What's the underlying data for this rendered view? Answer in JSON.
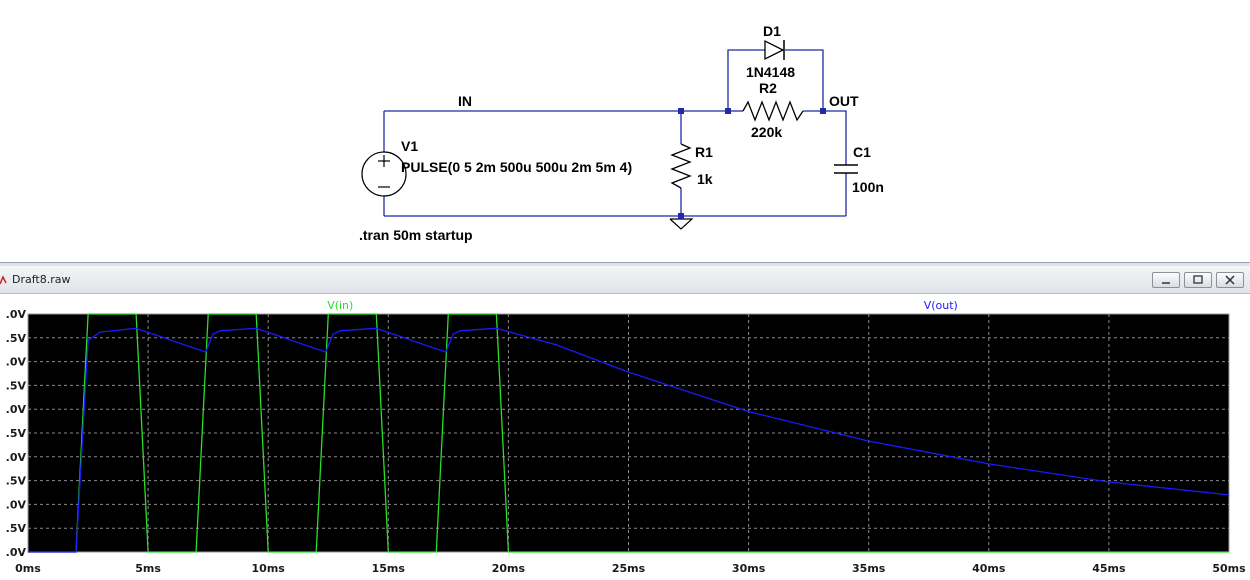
{
  "schematic": {
    "labels": {
      "net_in": "IN",
      "net_out": "OUT",
      "d1_name": "D1",
      "d1_model": "1N4148",
      "r2_name": "R2",
      "r2_value": "220k",
      "r1_name": "R1",
      "r1_value": "1k",
      "c1_name": "C1",
      "c1_value": "100n",
      "v1_name": "V1",
      "v1_value": "PULSE(0 5 2m 500u 500u 2m 5m 4)",
      "directive": ".tran 50m startup"
    }
  },
  "waveform_window": {
    "title": "Draft8.raw",
    "buttons": [
      "minimize",
      "restore",
      "close"
    ]
  },
  "chart_data": {
    "type": "line",
    "x_ticks": [
      "0ms",
      "5ms",
      "10ms",
      "15ms",
      "20ms",
      "25ms",
      "30ms",
      "35ms",
      "40ms",
      "45ms",
      "50ms"
    ],
    "y_ticks": [
      ".0V",
      ".5V",
      ".0V",
      ".5V",
      ".0V",
      ".5V",
      ".0V",
      ".5V",
      ".0V",
      ".5V",
      ".0V"
    ],
    "xlim": [
      0,
      50
    ],
    "ylim": [
      0,
      5
    ],
    "grid": true,
    "background": "#000000",
    "series": [
      {
        "name": "V(in)",
        "color": "#26e026",
        "x": [
          0,
          2,
          2.5,
          4.5,
          5,
          7,
          7.5,
          9.5,
          10,
          12,
          12.5,
          14.5,
          15,
          17,
          17.5,
          19.5,
          20,
          50
        ],
        "y": [
          0,
          0,
          5,
          5,
          0,
          0,
          5,
          5,
          0,
          0,
          5,
          5,
          0,
          0,
          5,
          5,
          0,
          0
        ]
      },
      {
        "name": "V(out)",
        "color": "#1a1aff",
        "x": [
          0,
          2,
          2.5,
          3,
          4.5,
          7.4,
          7.7,
          8,
          9.5,
          12.4,
          12.7,
          13,
          14.5,
          17.4,
          17.7,
          18,
          19.5,
          22,
          25,
          30,
          35,
          40,
          45,
          50
        ],
        "y": [
          0,
          0,
          4.45,
          4.62,
          4.7,
          4.2,
          4.58,
          4.65,
          4.7,
          4.2,
          4.58,
          4.65,
          4.7,
          4.2,
          4.58,
          4.65,
          4.7,
          4.35,
          3.78,
          2.95,
          2.33,
          1.85,
          1.47,
          1.2
        ]
      }
    ]
  }
}
